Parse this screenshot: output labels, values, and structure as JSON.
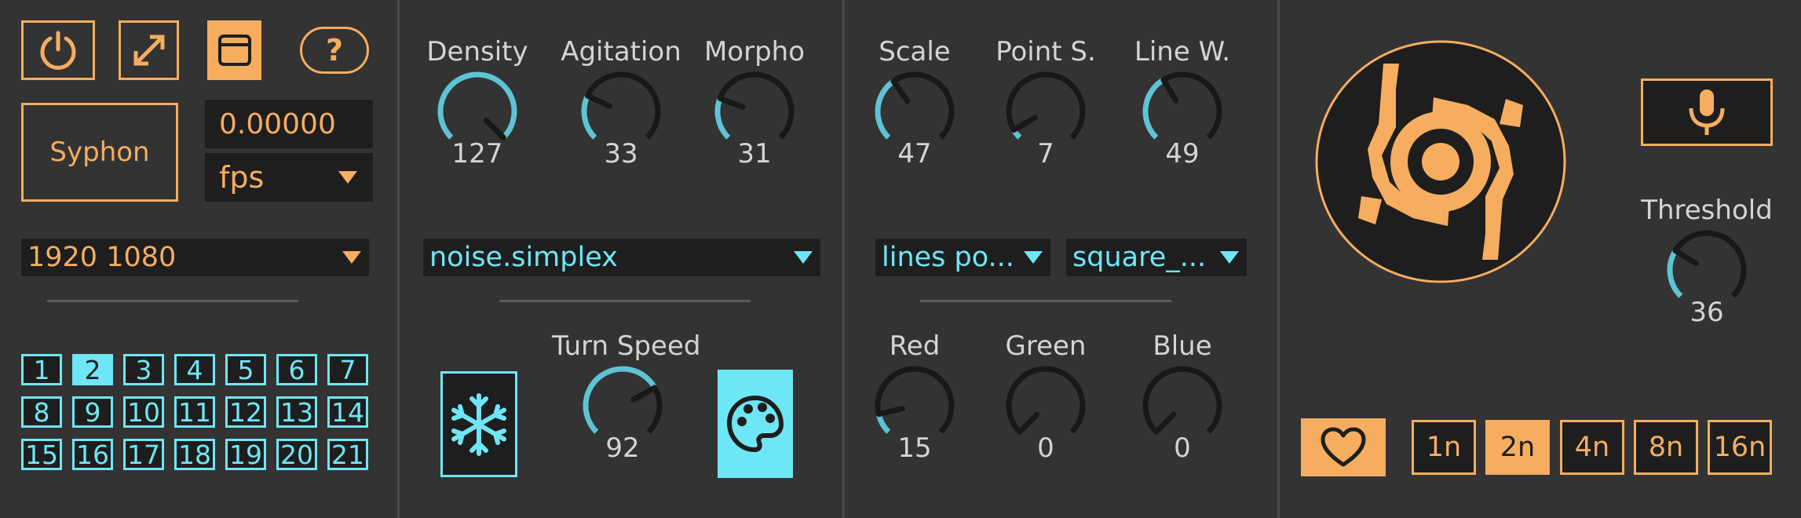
{
  "panel1": {
    "fps_value": "0.00000",
    "fps_unit": "fps",
    "syphon_label": "Syphon",
    "help_label": "?",
    "resolution": "1920 1080",
    "layers": [
      "1",
      "2",
      "3",
      "4",
      "5",
      "6",
      "7",
      "8",
      "9",
      "10",
      "11",
      "12",
      "13",
      "14",
      "15",
      "16",
      "17",
      "18",
      "19",
      "20",
      "21"
    ],
    "active_layer": "2"
  },
  "panel2": {
    "knobs": [
      {
        "label": "Density",
        "value": 127
      },
      {
        "label": "Agitation",
        "value": 33
      },
      {
        "label": "Morpho",
        "value": 31
      }
    ],
    "noise_mode": "noise.simplex",
    "turn_speed": {
      "label": "Turn Speed",
      "value": 92
    }
  },
  "panel3": {
    "knobs_top": [
      {
        "label": "Scale",
        "value": 47
      },
      {
        "label": "Point S.",
        "value": 7
      },
      {
        "label": "Line W.",
        "value": 49
      }
    ],
    "draw_mode": "lines po...",
    "shape_mode": "square_...",
    "knobs_bottom": [
      {
        "label": "Red",
        "value": 15
      },
      {
        "label": "Green",
        "value": 0
      },
      {
        "label": "Blue",
        "value": 0
      }
    ]
  },
  "panel4": {
    "threshold": {
      "label": "Threshold",
      "value": 36
    },
    "note_values": [
      "1n",
      "2n",
      "4n",
      "8n",
      "16n"
    ],
    "active_note": "2n"
  },
  "colors": {
    "accent_orange": "#f6ad5f",
    "accent_cyan": "#6fe6f6",
    "background": "#333333",
    "field": "#1e1e1e"
  },
  "icons": [
    "power-icon",
    "resize-icon",
    "window-icon",
    "help-icon",
    "snowflake-icon",
    "palette-icon",
    "logo",
    "microphone-icon",
    "heart-icon",
    "dropdown-arrow-icon"
  ]
}
